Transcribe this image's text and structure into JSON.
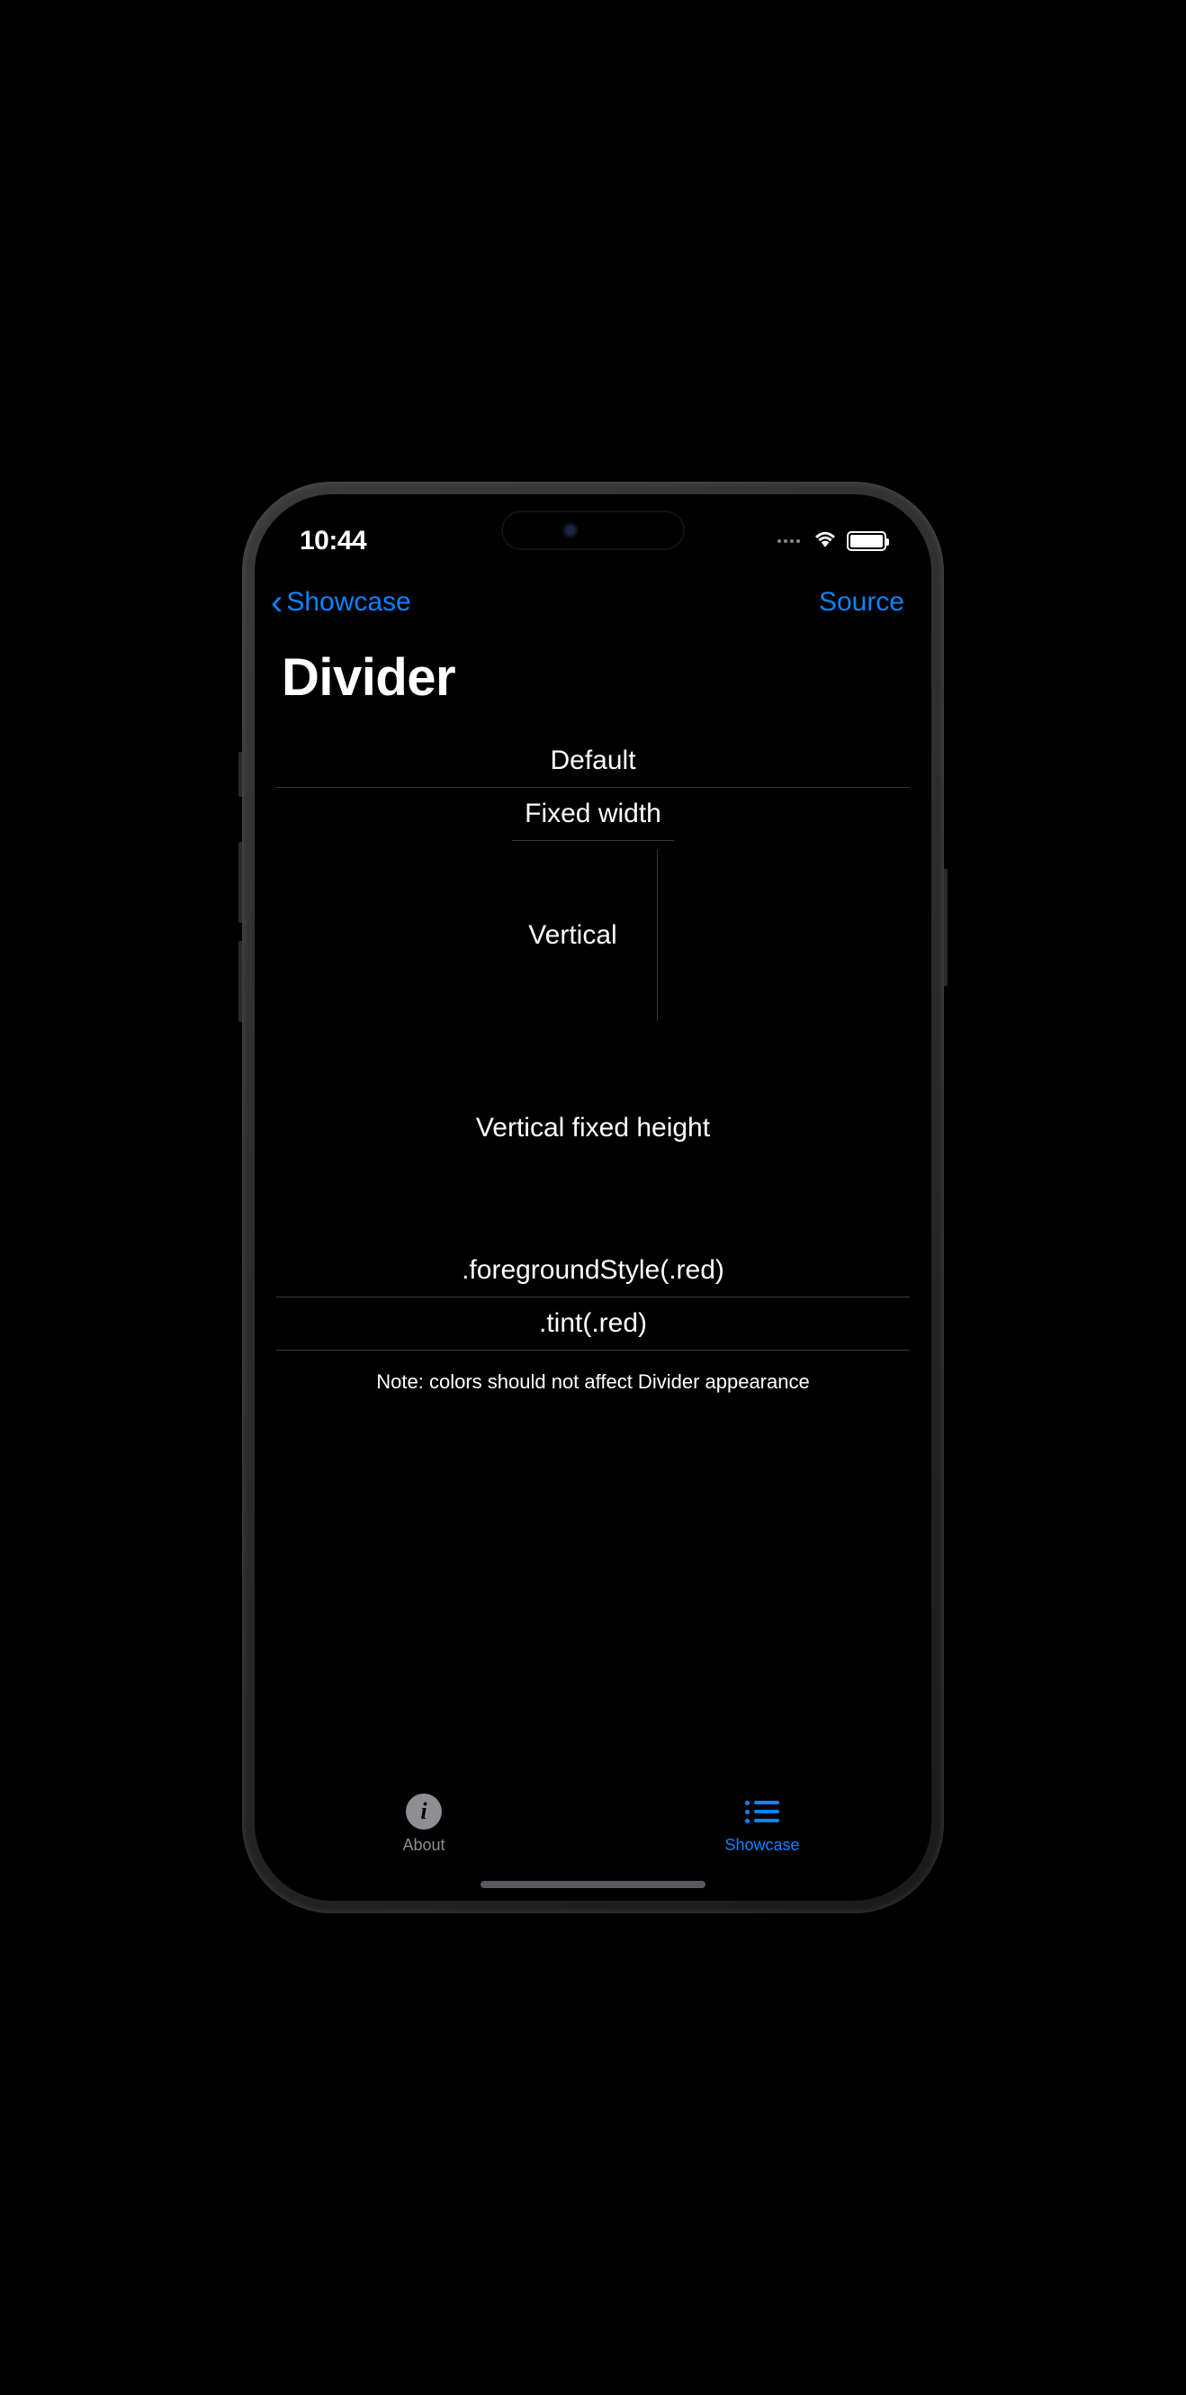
{
  "status": {
    "time": "10:44"
  },
  "nav": {
    "back_label": "Showcase",
    "source_label": "Source"
  },
  "page": {
    "title": "Divider"
  },
  "sections": {
    "default_label": "Default",
    "fixed_width_label": "Fixed width",
    "vertical_label": "Vertical",
    "vertical_fixed_label": "Vertical fixed height",
    "fg_style_label": ".foregroundStyle(.red)",
    "tint_label": ".tint(.red)",
    "note": "Note: colors should not affect Divider appearance"
  },
  "tabs": {
    "about_label": "About",
    "showcase_label": "Showcase"
  }
}
